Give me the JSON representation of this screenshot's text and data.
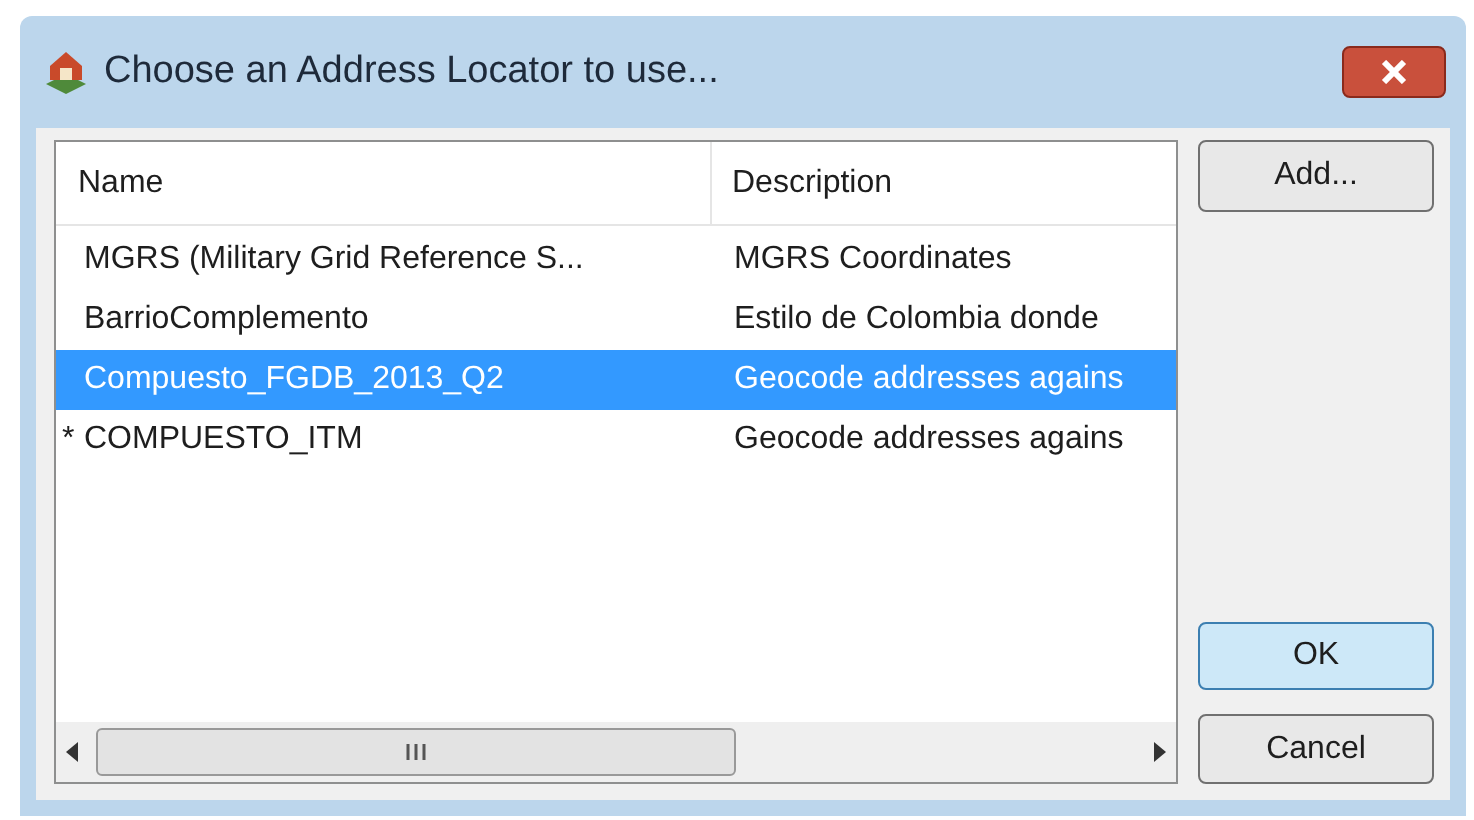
{
  "window": {
    "title": "Choose an Address Locator to use..."
  },
  "table": {
    "columns": [
      "Name",
      "Description"
    ],
    "rows": [
      {
        "marker": "",
        "name": "MGRS (Military Grid Reference S...",
        "description": "MGRS Coordinates",
        "selected": false
      },
      {
        "marker": "",
        "name": "BarrioComplemento",
        "description": "Estilo de Colombia donde",
        "selected": false
      },
      {
        "marker": "",
        "name": "Compuesto_FGDB_2013_Q2",
        "description": "Geocode addresses agains",
        "selected": true
      },
      {
        "marker": "*",
        "name": "COMPUESTO_ITM",
        "description": "Geocode addresses agains",
        "selected": false
      }
    ]
  },
  "buttons": {
    "add": "Add...",
    "ok": "OK",
    "cancel": "Cancel"
  }
}
